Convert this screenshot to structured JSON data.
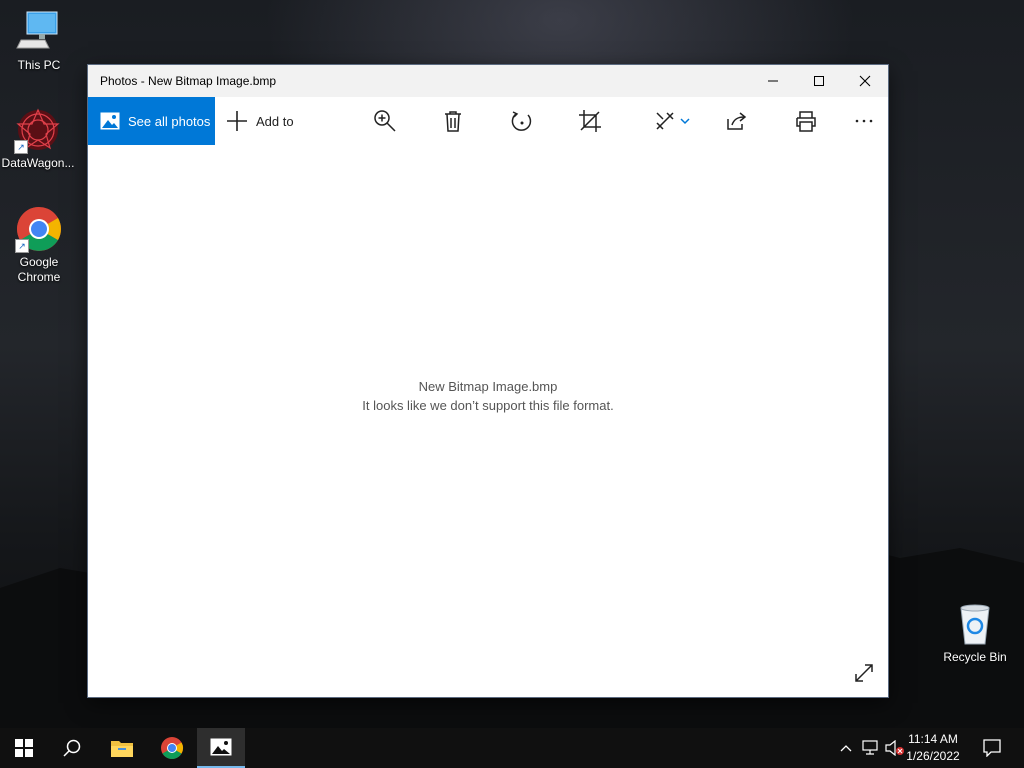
{
  "desktop": {
    "icons": [
      {
        "label": "This PC"
      },
      {
        "label": "DataWagon..."
      },
      {
        "label": "Google\nChrome"
      },
      {
        "label": "Recycle Bin"
      }
    ]
  },
  "window": {
    "title": "Photos - New Bitmap Image.bmp",
    "toolbar": {
      "see_all_label": "See all photos",
      "add_to_label": "Add to"
    },
    "content": {
      "filename": "New Bitmap Image.bmp",
      "message": "It looks like we don’t support this file format."
    }
  },
  "taskbar": {
    "time": "11:14 AM",
    "date": "1/26/2022"
  },
  "colors": {
    "accent": "#0078d7",
    "taskbar_bg": "#101010"
  }
}
